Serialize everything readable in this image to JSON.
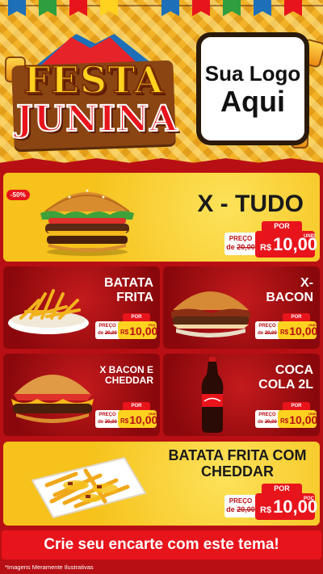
{
  "header": {
    "title_line1": "FESTA",
    "title_line2": "JUNINA",
    "logo_line1": "Sua Logo",
    "logo_line2": "Aqui"
  },
  "featured": {
    "name": "X - TUDO",
    "badge": "-50%",
    "por_label": "POR",
    "preco_label": "PREÇO",
    "de_label": "de",
    "old_price": "20,00",
    "currency": "R$",
    "price": "10,00",
    "unit": "UNID"
  },
  "items": [
    {
      "name_l1": "BATATA",
      "name_l2": "FRITA",
      "por_label": "POR",
      "preco_label": "PREÇO",
      "de_label": "de",
      "old_price": "20,00",
      "currency": "R$",
      "price": "10,00",
      "unit": "POÇ"
    },
    {
      "name_l1": "X-",
      "name_l2": "BACON",
      "por_label": "POR",
      "preco_label": "PREÇO",
      "de_label": "de",
      "old_price": "20,00",
      "currency": "R$",
      "price": "10,00",
      "unit": "UNID"
    },
    {
      "name_l1": "X BACON E",
      "name_l2": "CHEDDAR",
      "por_label": "POR",
      "preco_label": "PREÇO",
      "de_label": "de",
      "old_price": "20,00",
      "currency": "R$",
      "price": "10,00",
      "unit": "UNID"
    },
    {
      "name_l1": "COCA",
      "name_l2": "COLA 2L",
      "por_label": "POR",
      "preco_label": "PREÇO",
      "de_label": "de",
      "old_price": "20,00",
      "currency": "R$",
      "price": "10,00",
      "unit": "UNID"
    }
  ],
  "bottom_item": {
    "name_l1": "BATATA FRITA COM",
    "name_l2": "CHEDDAR",
    "por_label": "POR",
    "preco_label": "PREÇO",
    "de_label": "de",
    "old_price": "20,00",
    "currency": "R$",
    "price": "10,00",
    "unit": "POÇ"
  },
  "footer": {
    "cta": "Crie seu encarte com este tema!",
    "disclaimer": "*Imagens Meramente Ilustrativas"
  },
  "colors": {
    "red": "#e8141c",
    "dark_red": "#b80f14",
    "yellow": "#f6c21b",
    "price_yellow": "#ffd21f"
  }
}
